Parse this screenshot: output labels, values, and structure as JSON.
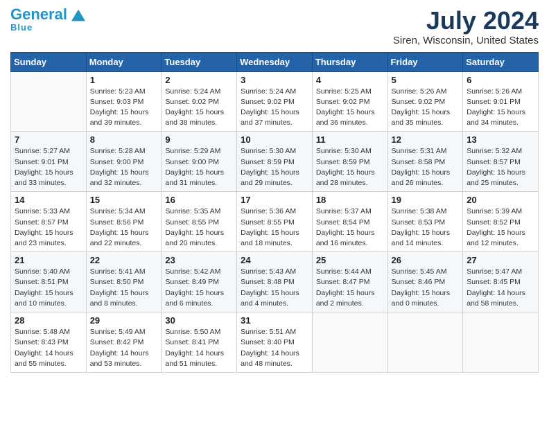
{
  "logo": {
    "line1_part1": "General",
    "line1_part2": "Blue",
    "line2": "Blue"
  },
  "title": "July 2024",
  "subtitle": "Siren, Wisconsin, United States",
  "days_of_week": [
    "Sunday",
    "Monday",
    "Tuesday",
    "Wednesday",
    "Thursday",
    "Friday",
    "Saturday"
  ],
  "weeks": [
    [
      {
        "day": "",
        "info": ""
      },
      {
        "day": "1",
        "info": "Sunrise: 5:23 AM\nSunset: 9:03 PM\nDaylight: 15 hours\nand 39 minutes."
      },
      {
        "day": "2",
        "info": "Sunrise: 5:24 AM\nSunset: 9:02 PM\nDaylight: 15 hours\nand 38 minutes."
      },
      {
        "day": "3",
        "info": "Sunrise: 5:24 AM\nSunset: 9:02 PM\nDaylight: 15 hours\nand 37 minutes."
      },
      {
        "day": "4",
        "info": "Sunrise: 5:25 AM\nSunset: 9:02 PM\nDaylight: 15 hours\nand 36 minutes."
      },
      {
        "day": "5",
        "info": "Sunrise: 5:26 AM\nSunset: 9:02 PM\nDaylight: 15 hours\nand 35 minutes."
      },
      {
        "day": "6",
        "info": "Sunrise: 5:26 AM\nSunset: 9:01 PM\nDaylight: 15 hours\nand 34 minutes."
      }
    ],
    [
      {
        "day": "7",
        "info": "Sunrise: 5:27 AM\nSunset: 9:01 PM\nDaylight: 15 hours\nand 33 minutes."
      },
      {
        "day": "8",
        "info": "Sunrise: 5:28 AM\nSunset: 9:00 PM\nDaylight: 15 hours\nand 32 minutes."
      },
      {
        "day": "9",
        "info": "Sunrise: 5:29 AM\nSunset: 9:00 PM\nDaylight: 15 hours\nand 31 minutes."
      },
      {
        "day": "10",
        "info": "Sunrise: 5:30 AM\nSunset: 8:59 PM\nDaylight: 15 hours\nand 29 minutes."
      },
      {
        "day": "11",
        "info": "Sunrise: 5:30 AM\nSunset: 8:59 PM\nDaylight: 15 hours\nand 28 minutes."
      },
      {
        "day": "12",
        "info": "Sunrise: 5:31 AM\nSunset: 8:58 PM\nDaylight: 15 hours\nand 26 minutes."
      },
      {
        "day": "13",
        "info": "Sunrise: 5:32 AM\nSunset: 8:57 PM\nDaylight: 15 hours\nand 25 minutes."
      }
    ],
    [
      {
        "day": "14",
        "info": "Sunrise: 5:33 AM\nSunset: 8:57 PM\nDaylight: 15 hours\nand 23 minutes."
      },
      {
        "day": "15",
        "info": "Sunrise: 5:34 AM\nSunset: 8:56 PM\nDaylight: 15 hours\nand 22 minutes."
      },
      {
        "day": "16",
        "info": "Sunrise: 5:35 AM\nSunset: 8:55 PM\nDaylight: 15 hours\nand 20 minutes."
      },
      {
        "day": "17",
        "info": "Sunrise: 5:36 AM\nSunset: 8:55 PM\nDaylight: 15 hours\nand 18 minutes."
      },
      {
        "day": "18",
        "info": "Sunrise: 5:37 AM\nSunset: 8:54 PM\nDaylight: 15 hours\nand 16 minutes."
      },
      {
        "day": "19",
        "info": "Sunrise: 5:38 AM\nSunset: 8:53 PM\nDaylight: 15 hours\nand 14 minutes."
      },
      {
        "day": "20",
        "info": "Sunrise: 5:39 AM\nSunset: 8:52 PM\nDaylight: 15 hours\nand 12 minutes."
      }
    ],
    [
      {
        "day": "21",
        "info": "Sunrise: 5:40 AM\nSunset: 8:51 PM\nDaylight: 15 hours\nand 10 minutes."
      },
      {
        "day": "22",
        "info": "Sunrise: 5:41 AM\nSunset: 8:50 PM\nDaylight: 15 hours\nand 8 minutes."
      },
      {
        "day": "23",
        "info": "Sunrise: 5:42 AM\nSunset: 8:49 PM\nDaylight: 15 hours\nand 6 minutes."
      },
      {
        "day": "24",
        "info": "Sunrise: 5:43 AM\nSunset: 8:48 PM\nDaylight: 15 hours\nand 4 minutes."
      },
      {
        "day": "25",
        "info": "Sunrise: 5:44 AM\nSunset: 8:47 PM\nDaylight: 15 hours\nand 2 minutes."
      },
      {
        "day": "26",
        "info": "Sunrise: 5:45 AM\nSunset: 8:46 PM\nDaylight: 15 hours\nand 0 minutes."
      },
      {
        "day": "27",
        "info": "Sunrise: 5:47 AM\nSunset: 8:45 PM\nDaylight: 14 hours\nand 58 minutes."
      }
    ],
    [
      {
        "day": "28",
        "info": "Sunrise: 5:48 AM\nSunset: 8:43 PM\nDaylight: 14 hours\nand 55 minutes."
      },
      {
        "day": "29",
        "info": "Sunrise: 5:49 AM\nSunset: 8:42 PM\nDaylight: 14 hours\nand 53 minutes."
      },
      {
        "day": "30",
        "info": "Sunrise: 5:50 AM\nSunset: 8:41 PM\nDaylight: 14 hours\nand 51 minutes."
      },
      {
        "day": "31",
        "info": "Sunrise: 5:51 AM\nSunset: 8:40 PM\nDaylight: 14 hours\nand 48 minutes."
      },
      {
        "day": "",
        "info": ""
      },
      {
        "day": "",
        "info": ""
      },
      {
        "day": "",
        "info": ""
      }
    ]
  ]
}
